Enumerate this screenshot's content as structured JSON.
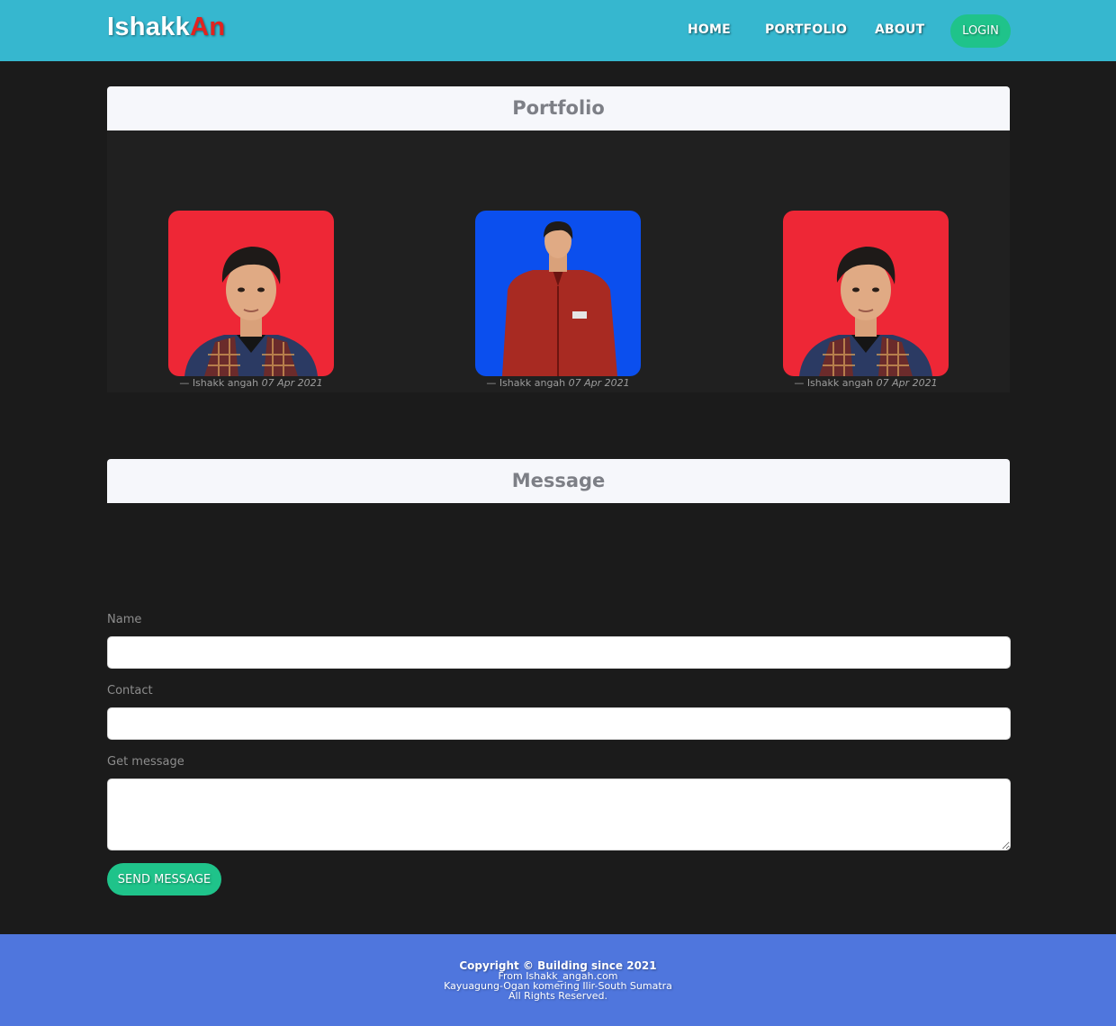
{
  "navbar": {
    "brand_part1": "Ishakk",
    "brand_part2": "An",
    "links": [
      "HOME",
      "PORTFOLIO",
      "ABOUT"
    ],
    "login_label": "LOGIN"
  },
  "portfolio": {
    "title": "Portfolio",
    "items": [
      {
        "author": "Ishakk angah",
        "date": "07 Apr 2021",
        "photo_bg": "#ee2736",
        "photo": "person-portrait-red-background"
      },
      {
        "author": "Ishakk angah",
        "date": "07 Apr 2021",
        "photo_bg": "#0b4fee",
        "photo": "person-halfbody-blue-background"
      },
      {
        "author": "Ishakk angah",
        "date": "07 Apr 2021",
        "photo_bg": "#ee2736",
        "photo": "person-portrait-red-background"
      }
    ],
    "caption_dash": "—"
  },
  "message": {
    "title": "Message",
    "fields": {
      "name_label": "Name",
      "name_value": "",
      "contact_label": "Contact",
      "contact_value": "",
      "message_label": "Get message",
      "message_value": ""
    },
    "send_label": "SEND MESSAGE"
  },
  "footer": {
    "copyright": "Copyright © Building since 2021",
    "line2": "From Ishakk_angah.com",
    "line3": "Kayuagung-Ogan komering Ilir-South Sumatra",
    "line4": "All Rights Reserved."
  },
  "colors": {
    "navbar": "#36b7cf",
    "accent_green": "#1fc38a",
    "brand_red": "#e3231f",
    "footer": "#4f76dd",
    "page_bg": "#1b1b1b"
  }
}
